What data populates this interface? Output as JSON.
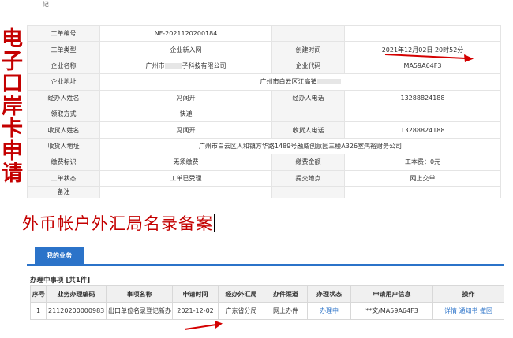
{
  "top_fragment": "记",
  "vertical_title": [
    "电",
    "子",
    "口",
    "岸",
    "卡",
    "申",
    "请"
  ],
  "form": {
    "rows": [
      {
        "l1": "工单编号",
        "v1": "NF-2021120200184",
        "l2": "",
        "v2": ""
      },
      {
        "l1": "工单类型",
        "v1": "企业新入网",
        "l2": "创建时间",
        "v2": "2021年12月02日 20时52分"
      },
      {
        "l1": "企业名称",
        "v1": "广州市",
        "v1b": "子科技有限公司",
        "l2": "企业代码",
        "v2": "MA59A64F3"
      },
      {
        "l1": "企业地址",
        "full": "广州市白云区江高镇"
      },
      {
        "l1": "经办人姓名",
        "v1": "冯闻开",
        "l2": "经办人电话",
        "v2": "13288824188"
      },
      {
        "l1": "领取方式",
        "v1": "快递",
        "l2": "",
        "v2": ""
      },
      {
        "l1": "收货人姓名",
        "v1": "冯闻开",
        "l2": "收货人电话",
        "v2": "13288824188"
      },
      {
        "l1": "收货人地址",
        "full": "广州市白云区人和镇方华路1489号融威创意园三楼A326室鸿裕财务公司"
      },
      {
        "l1": "缴费标识",
        "v1": "无须缴费",
        "l2": "缴费金额",
        "v2": "工本费：0元"
      },
      {
        "l1": "工单状态",
        "v1": "工单已受理",
        "l2": "提交地点",
        "v2": "网上交单"
      },
      {
        "l1": "备注",
        "v1": "",
        "l2": "",
        "v2": ""
      }
    ]
  },
  "subtitle": "外币帐户外汇局名录备案",
  "tab_label": "我的业务",
  "section_title": "办理中事项 [共1件]",
  "table": {
    "headers": [
      "序号",
      "业务办理编码",
      "事项名称",
      "申请时间",
      "经办外汇局",
      "办件渠道",
      "办理状态",
      "申请用户信息",
      "操作"
    ],
    "rows": [
      {
        "no": "1",
        "code": "21120200000983",
        "item": "出口单位名录登记新办",
        "date": "2021-12-02",
        "bureau": "广东省分局",
        "channel": "网上办件",
        "status": "办理中",
        "user": "**文/MA59A64F3",
        "ops": [
          "详情",
          "通知书",
          "撤回"
        ]
      }
    ]
  },
  "colors": {
    "accent_red": "#c40000",
    "tab_blue": "#2b73c9"
  }
}
